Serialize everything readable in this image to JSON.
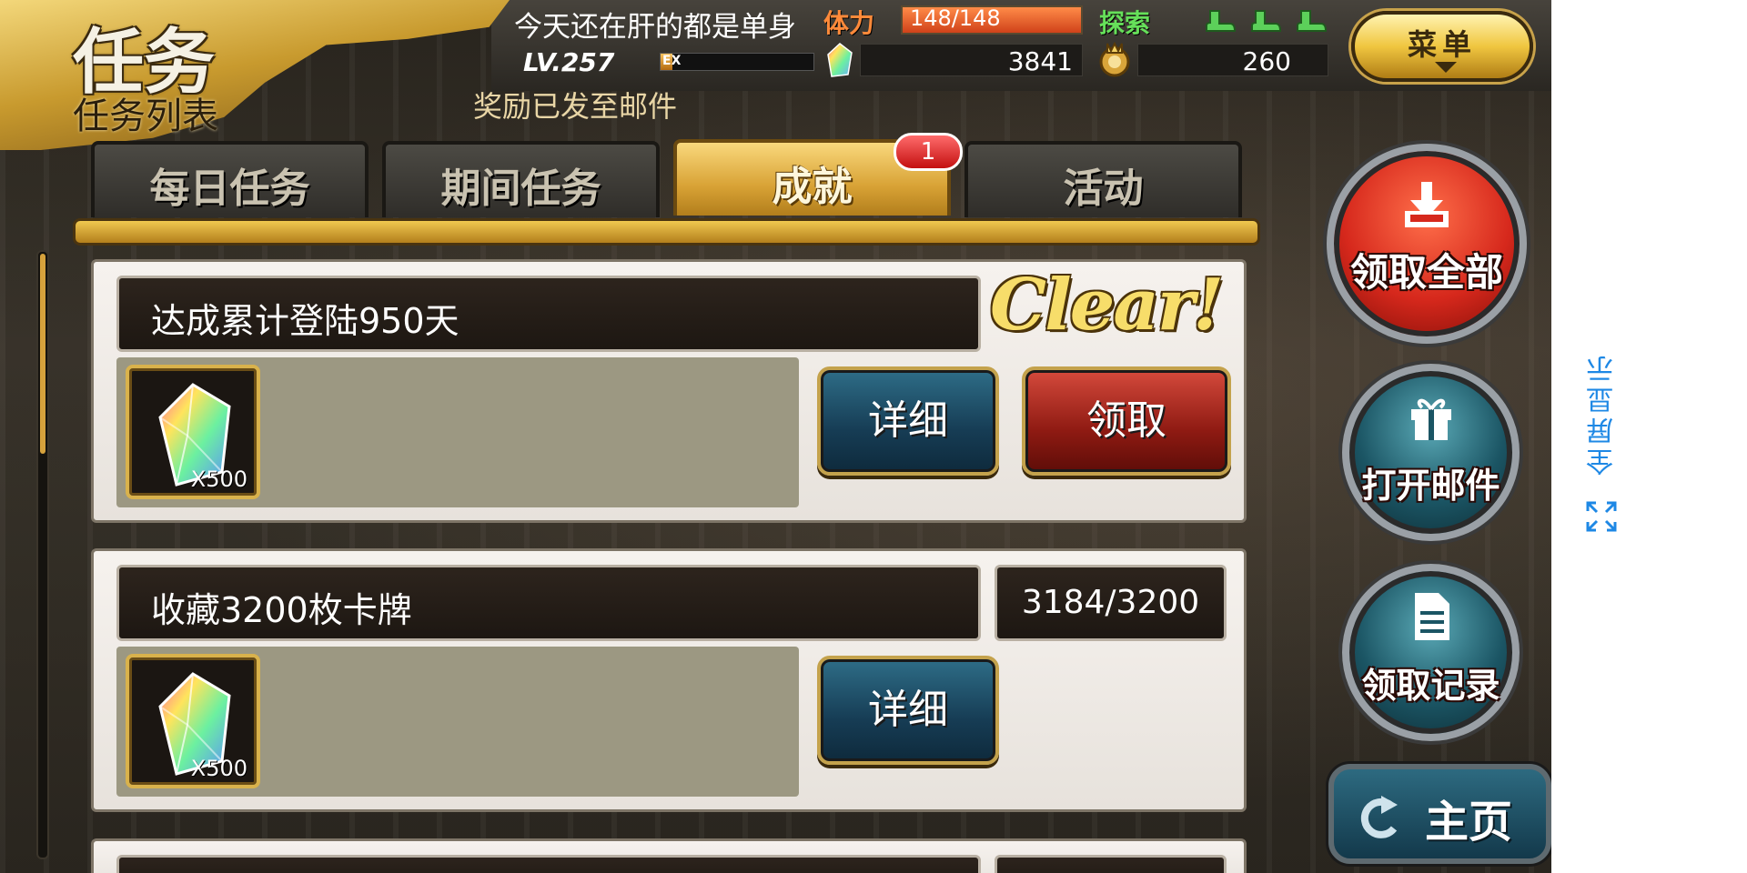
{
  "header": {
    "title": "任务",
    "subtitle": "任务列表",
    "player_name": "今天还在肝的都是单身",
    "level": "LV.257",
    "exp_label": "EX",
    "exp_fraction": 0.08,
    "stamina_label": "体力",
    "stamina_value": "148/148",
    "stamina_fraction": 1.0,
    "explore_label": "探索",
    "explore_count": 3,
    "gems": "3841",
    "coins": "260",
    "menu_label": "菜单",
    "notice": "奖励已发至邮件"
  },
  "tabs": [
    {
      "label": "每日任务",
      "active": false
    },
    {
      "label": "期间任务",
      "active": false
    },
    {
      "label": "成就",
      "active": true,
      "badge": "1"
    },
    {
      "label": "活动",
      "active": false
    }
  ],
  "tasks": [
    {
      "title": "达成累计登陆950天",
      "status": "Clear!",
      "reward_qty": "X500",
      "detail_label": "详细",
      "claim_label": "领取"
    },
    {
      "title": "收藏3200枚卡牌",
      "status": "3184/3200",
      "reward_qty": "X500",
      "detail_label": "详细"
    }
  ],
  "side_actions": {
    "claim_all": "领取全部",
    "open_mail": "打开邮件",
    "claim_history": "领取记录",
    "home": "主页"
  },
  "system": {
    "fullscreen_label": "全屏显示",
    "fullscreen_color": "#1e88e5"
  },
  "scroll": {
    "position_fraction": 0.0
  }
}
